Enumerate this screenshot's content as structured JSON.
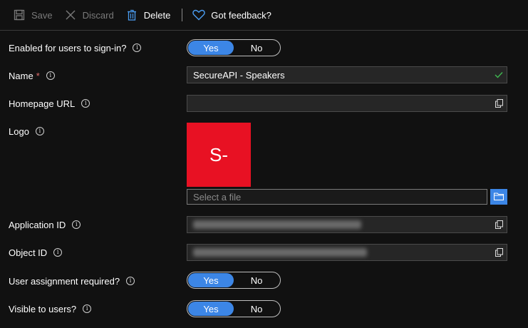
{
  "toolbar": {
    "save_label": "Save",
    "discard_label": "Discard",
    "delete_label": "Delete",
    "feedback_label": "Got feedback?"
  },
  "form": {
    "enabled": {
      "label": "Enabled for users to sign-in?",
      "yes": "Yes",
      "no": "No",
      "selected": "Yes"
    },
    "name": {
      "label": "Name",
      "required_mark": "*",
      "value": "SecureAPI - Speakers",
      "status": "valid"
    },
    "homepage": {
      "label": "Homepage URL",
      "value": ""
    },
    "logo": {
      "label": "Logo",
      "initials": "S-",
      "tile_color": "#e81123",
      "file_placeholder": "Select a file"
    },
    "app_id": {
      "label": "Application ID",
      "value_state": "blurred"
    },
    "object_id": {
      "label": "Object ID",
      "value_state": "blurred"
    },
    "assignment": {
      "label": "User assignment required?",
      "yes": "Yes",
      "no": "No",
      "selected": "Yes"
    },
    "visible": {
      "label": "Visible to users?",
      "yes": "Yes",
      "no": "No",
      "selected": "Yes"
    }
  },
  "colors": {
    "accent": "#3c86e6",
    "background": "#111111",
    "field_bg": "#262626",
    "required": "#e06c6c",
    "valid_check": "#3fb950"
  },
  "icons": {
    "save": "save-icon",
    "discard": "discard-x-icon",
    "delete": "trash-icon",
    "feedback": "heart-icon",
    "info": "info-icon",
    "copy": "copy-icon",
    "folder": "folder-icon",
    "check": "check-icon"
  }
}
